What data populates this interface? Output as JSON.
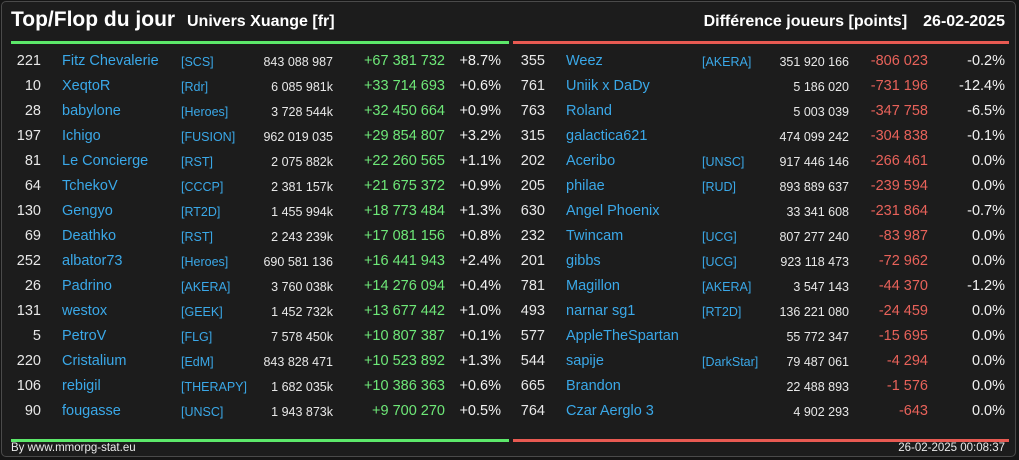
{
  "header": {
    "title": "Top/Flop du jour",
    "universe": "Univers Xuange [fr]",
    "metric": "Différence joueurs [points]",
    "date": "26-02-2025"
  },
  "top": [
    {
      "rank": "221",
      "name": "Fitz Chevalerie",
      "ally": "[SCS]",
      "points": "843 088 987",
      "diff": "+67 381 732",
      "pct": "+8.7%"
    },
    {
      "rank": "10",
      "name": "XeqtoR",
      "ally": "[Rdr]",
      "points": "6 085 981k",
      "diff": "+33 714 693",
      "pct": "+0.6%"
    },
    {
      "rank": "28",
      "name": "babylone",
      "ally": "[Heroes]",
      "points": "3 728 544k",
      "diff": "+32 450 664",
      "pct": "+0.9%"
    },
    {
      "rank": "197",
      "name": "Ichigo",
      "ally": "[FUSION]",
      "points": "962 019 035",
      "diff": "+29 854 807",
      "pct": "+3.2%"
    },
    {
      "rank": "81",
      "name": "Le Concierge",
      "ally": "[RST]",
      "points": "2 075 882k",
      "diff": "+22 260 565",
      "pct": "+1.1%"
    },
    {
      "rank": "64",
      "name": "TchekoV",
      "ally": "[CCCP]",
      "points": "2 381 157k",
      "diff": "+21 675 372",
      "pct": "+0.9%"
    },
    {
      "rank": "130",
      "name": "Gengyo",
      "ally": "[RT2D]",
      "points": "1 455 994k",
      "diff": "+18 773 484",
      "pct": "+1.3%"
    },
    {
      "rank": "69",
      "name": "Deathko",
      "ally": "[RST]",
      "points": "2 243 239k",
      "diff": "+17 081 156",
      "pct": "+0.8%"
    },
    {
      "rank": "252",
      "name": "albator73",
      "ally": "[Heroes]",
      "points": "690 581 136",
      "diff": "+16 441 943",
      "pct": "+2.4%"
    },
    {
      "rank": "26",
      "name": "Padrino",
      "ally": "[AKERA]",
      "points": "3 760 038k",
      "diff": "+14 276 094",
      "pct": "+0.4%"
    },
    {
      "rank": "131",
      "name": "westox",
      "ally": "[GEEK]",
      "points": "1 452 732k",
      "diff": "+13 677 442",
      "pct": "+1.0%"
    },
    {
      "rank": "5",
      "name": "PetroV",
      "ally": "[FLG]",
      "points": "7 578 450k",
      "diff": "+10 807 387",
      "pct": "+0.1%"
    },
    {
      "rank": "220",
      "name": "Cristalium",
      "ally": "[EdM]",
      "points": "843 828 471",
      "diff": "+10 523 892",
      "pct": "+1.3%"
    },
    {
      "rank": "106",
      "name": "rebigil",
      "ally": "[THERAPY]",
      "points": "1 682 035k",
      "diff": "+10 386 363",
      "pct": "+0.6%"
    },
    {
      "rank": "90",
      "name": "fougasse",
      "ally": "[UNSC]",
      "points": "1 943 873k",
      "diff": "+9 700 270",
      "pct": "+0.5%"
    }
  ],
  "flop": [
    {
      "rank": "355",
      "name": "Weez",
      "ally": "[AKERA]",
      "points": "351 920 166",
      "diff": "-806 023",
      "pct": "-0.2%"
    },
    {
      "rank": "761",
      "name": "Uniik x DaDy",
      "ally": "",
      "points": "5 186 020",
      "diff": "-731 196",
      "pct": "-12.4%"
    },
    {
      "rank": "763",
      "name": "Roland",
      "ally": "",
      "points": "5 003 039",
      "diff": "-347 758",
      "pct": "-6.5%"
    },
    {
      "rank": "315",
      "name": "galactica621",
      "ally": "",
      "points": "474 099 242",
      "diff": "-304 838",
      "pct": "-0.1%"
    },
    {
      "rank": "202",
      "name": "Aceribo",
      "ally": "[UNSC]",
      "points": "917 446 146",
      "diff": "-266 461",
      "pct": "0.0%"
    },
    {
      "rank": "205",
      "name": "philae",
      "ally": "[RUD]",
      "points": "893 889 637",
      "diff": "-239 594",
      "pct": "0.0%"
    },
    {
      "rank": "630",
      "name": "Angel Phoenix",
      "ally": "",
      "points": "33 341 608",
      "diff": "-231 864",
      "pct": "-0.7%"
    },
    {
      "rank": "232",
      "name": "Twincam",
      "ally": "[UCG]",
      "points": "807 277 240",
      "diff": "-83 987",
      "pct": "0.0%"
    },
    {
      "rank": "201",
      "name": "gibbs",
      "ally": "[UCG]",
      "points": "923 118 473",
      "diff": "-72 962",
      "pct": "0.0%"
    },
    {
      "rank": "781",
      "name": "Magillon",
      "ally": "[AKERA]",
      "points": "3 547 143",
      "diff": "-44 370",
      "pct": "-1.2%"
    },
    {
      "rank": "493",
      "name": "narnar sg1",
      "ally": "[RT2D]",
      "points": "136 221 080",
      "diff": "-24 459",
      "pct": "0.0%"
    },
    {
      "rank": "577",
      "name": "AppleTheSpartan",
      "ally": "",
      "points": "55 772 347",
      "diff": "-15 695",
      "pct": "0.0%"
    },
    {
      "rank": "544",
      "name": "sapije",
      "ally": "[DarkStar]",
      "points": "79 487 061",
      "diff": "-4 294",
      "pct": "0.0%"
    },
    {
      "rank": "665",
      "name": "Brandon",
      "ally": "",
      "points": "22 488 893",
      "diff": "-1 576",
      "pct": "0.0%"
    },
    {
      "rank": "764",
      "name": "Czar Aerglo 3",
      "ally": "",
      "points": "4 902 293",
      "diff": "-643",
      "pct": "0.0%"
    }
  ],
  "footer": {
    "credit": "By www.mmorpg-stat.eu",
    "timestamp": "26-02-2025 00:08:37"
  },
  "colors": {
    "top_accent": "#5ce86a",
    "flop_accent": "#e85a52",
    "link": "#3aa8e8",
    "background": "#1c1c1c"
  }
}
